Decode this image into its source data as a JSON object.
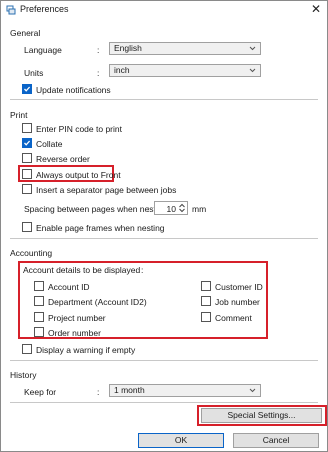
{
  "window": {
    "title": "Preferences"
  },
  "general": {
    "title": "General",
    "language": {
      "label": "Language",
      "value": "English"
    },
    "units": {
      "label": "Units",
      "value": "inch"
    },
    "update_notifications": {
      "label": "Update notifications",
      "checked": true
    }
  },
  "print": {
    "title": "Print",
    "enter_pin": {
      "label": "Enter PIN code to print",
      "checked": false
    },
    "collate": {
      "label": "Collate",
      "checked": true
    },
    "reverse_order": {
      "label": "Reverse order",
      "checked": false
    },
    "always_front": {
      "label": "Always output to Front",
      "checked": false
    },
    "separator_page": {
      "label": "Insert a separator page between jobs",
      "checked": false
    },
    "spacing": {
      "label": "Spacing between pages when nesting",
      "value": "10",
      "unit": "mm"
    },
    "page_frames": {
      "label": "Enable page frames when nesting",
      "checked": false
    }
  },
  "accounting": {
    "title": "Accounting",
    "details_label": "Account details to be displayed",
    "left_items": [
      {
        "label": "Account ID",
        "checked": false
      },
      {
        "label": "Department (Account ID2)",
        "checked": false
      },
      {
        "label": "Project number",
        "checked": false
      },
      {
        "label": "Order number",
        "checked": false
      }
    ],
    "right_items": [
      {
        "label": "Customer ID",
        "checked": false
      },
      {
        "label": "Job number",
        "checked": false
      },
      {
        "label": "Comment",
        "checked": false
      }
    ],
    "warning_empty": {
      "label": "Display a warning if empty",
      "checked": false
    }
  },
  "history": {
    "title": "History",
    "keep_for": {
      "label": "Keep for",
      "value": "1 month"
    }
  },
  "buttons": {
    "special_settings": "Special Settings...",
    "ok": "OK",
    "cancel": "Cancel"
  },
  "colors": {
    "accent": "#0a64c8",
    "highlight": "#d6202a"
  }
}
